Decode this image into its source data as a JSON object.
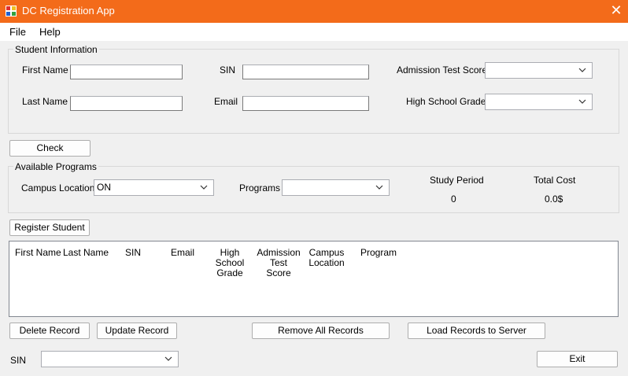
{
  "window": {
    "title": "DC Registration App"
  },
  "menu": {
    "file": "File",
    "help": "Help"
  },
  "student_info": {
    "title": "Student Information",
    "first_name_label": "First Name",
    "last_name_label": "Last Name",
    "sin_label": "SIN",
    "email_label": "Email",
    "admission_label": "Admission Test Score",
    "grade_label": "High School Grade",
    "first_name_value": "",
    "last_name_value": "",
    "sin_value": "",
    "email_value": "",
    "admission_value": "",
    "grade_value": ""
  },
  "check_button": "Check",
  "programs": {
    "title": "Available Programs",
    "campus_label": "Campus Location",
    "campus_value": "ON",
    "programs_label": "Programs",
    "programs_value": "",
    "study_period_label": "Study Period",
    "study_period_value": "0",
    "total_cost_label": "Total Cost",
    "total_cost_value": "0.0$"
  },
  "register_button": "Register Student",
  "records": {
    "columns": {
      "first_name": "First Name",
      "last_name": "Last Name",
      "sin": "SIN",
      "email": "Email",
      "grade_1": "High School",
      "grade_2": "Grade",
      "admission_1": "Admission",
      "admission_2": "Test Score",
      "campus_1": "Campus",
      "campus_2": "Location",
      "program": "Program"
    }
  },
  "actions": {
    "delete": "Delete Record",
    "update": "Update Record",
    "remove_all": "Remove All Records",
    "load": "Load Records to Server",
    "exit": "Exit"
  },
  "bottom": {
    "sin_label": "SIN",
    "sin_value": ""
  },
  "colors": {
    "titlebar": "#f36b1a",
    "background": "#f0f0f0"
  }
}
